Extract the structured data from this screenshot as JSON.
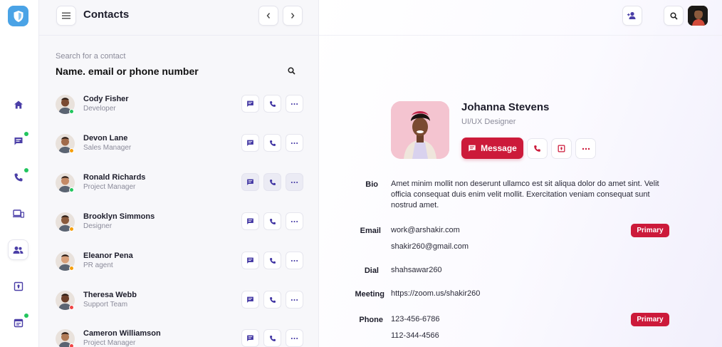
{
  "panel": {
    "title": "Contacts",
    "search_label": "Search for a contact",
    "search_placeholder": "Name. email or phone number"
  },
  "contacts": [
    {
      "name": "Cody Fisher",
      "role": "Developer",
      "status_color": "#22c55e"
    },
    {
      "name": "Devon Lane",
      "role": "Sales Manager",
      "status_color": "#f59e0b"
    },
    {
      "name": "Ronald Richards",
      "role": "Project Manager",
      "status_color": "#22c55e"
    },
    {
      "name": "Brooklyn Simmons",
      "role": "Designer",
      "status_color": "#f59e0b"
    },
    {
      "name": "Eleanor Pena",
      "role": "PR agent",
      "status_color": "#f59e0b"
    },
    {
      "name": "Theresa Webb",
      "role": "Support Team",
      "status_color": "#ef4444"
    },
    {
      "name": "Cameron Williamson",
      "role": "Project Manager",
      "status_color": "#ef4444"
    }
  ],
  "profile": {
    "name": "Johanna Stevens",
    "role": "UI/UX Designer",
    "message_label": "Message",
    "fields": {
      "bio_label": "Bio",
      "bio_text": "Amet minim mollit non deserunt ullamco est sit aliqua dolor do amet sint. Velit officia consequat duis enim velit mollit. Exercitation veniam consequat sunt nostrud amet.",
      "email_label": "Email",
      "email_primary": "work@arshakir.com",
      "email_secondary": "shakir260@gmail.com",
      "dial_label": "Dial",
      "dial_value": "shahsawar260",
      "meeting_label": "Meeting",
      "meeting_value": "https://zoom.us/shakir260",
      "phone_label": "Phone",
      "phone_primary": "123-456-6786",
      "phone_secondary": "112-344-4566",
      "primary_badge": "Primary"
    }
  },
  "colors": {
    "accent_red": "#cc1a3a",
    "nav_purple": "#4b3fa7",
    "logo_blue": "#4aa3e6",
    "online_green": "#22c55e"
  },
  "icons": {
    "rail": [
      "shield-logo-icon",
      "home-icon",
      "chat-icon",
      "phone-icon",
      "devices-icon",
      "contacts-icon",
      "upload-box-icon",
      "calendar-icon"
    ],
    "header": [
      "menu-icon",
      "chevron-left-icon",
      "chevron-right-icon",
      "add-user-icon",
      "search-icon"
    ]
  }
}
